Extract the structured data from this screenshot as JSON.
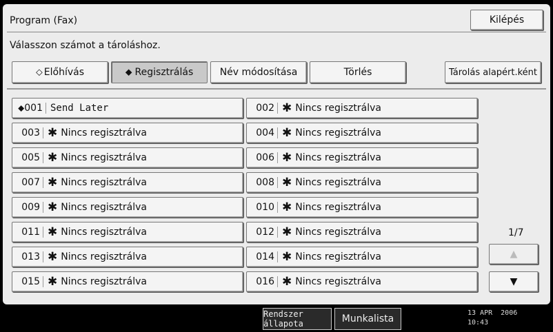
{
  "header": {
    "title": "Program (Fax)",
    "exit_label": "Kilépés"
  },
  "instruction": "Válasszon számot a tároláshoz.",
  "tabs": [
    {
      "label": "Előhívás",
      "icon": "diamond-arrow-icon",
      "active": false
    },
    {
      "label": "Regisztrálás",
      "icon": "diamond-arrow-icon",
      "active": true
    },
    {
      "label": "Név módosítása",
      "active": false
    },
    {
      "label": "Törlés",
      "active": false
    }
  ],
  "store_default_label": "Tárolás alapért.ként",
  "slots": [
    {
      "num": "001",
      "label": "Send Later"
    },
    {
      "num": "002",
      "label": "Nincs regisztrálva"
    },
    {
      "num": "003",
      "label": "Nincs regisztrálva"
    },
    {
      "num": "004",
      "label": "Nincs regisztrálva"
    },
    {
      "num": "005",
      "label": "Nincs regisztrálva"
    },
    {
      "num": "006",
      "label": "Nincs regisztrálva"
    },
    {
      "num": "007",
      "label": "Nincs regisztrálva"
    },
    {
      "num": "008",
      "label": "Nincs regisztrálva"
    },
    {
      "num": "009",
      "label": "Nincs regisztrálva"
    },
    {
      "num": "010",
      "label": "Nincs regisztrálva"
    },
    {
      "num": "011",
      "label": "Nincs regisztrálva"
    },
    {
      "num": "012",
      "label": "Nincs regisztrálva"
    },
    {
      "num": "013",
      "label": "Nincs regisztrálva"
    },
    {
      "num": "014",
      "label": "Nincs regisztrálva"
    },
    {
      "num": "015",
      "label": "Nincs regisztrálva"
    },
    {
      "num": "016",
      "label": "Nincs regisztrálva"
    }
  ],
  "unregistered_mark": "✱",
  "pager": {
    "text": "1/7",
    "up": "▲",
    "down": "▼"
  },
  "status_bar": {
    "system_status": "Rendszer állapota",
    "job_list": "Munkalista",
    "date": "13 APR  2006",
    "time": "10:43"
  }
}
